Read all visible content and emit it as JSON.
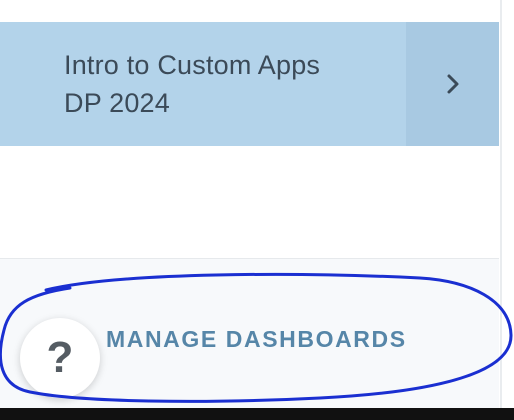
{
  "dashboard_item": {
    "label_line1": "Intro to Custom Apps",
    "label_line2": "DP 2024",
    "chevron_icon": "chevron-right-icon"
  },
  "bottom_panel": {
    "manage_label": "MANAGE DASHBOARDS",
    "help_label": "?",
    "help_icon": "question-mark-icon"
  },
  "colors": {
    "item_bg": "#b3d3ea",
    "chevron_bg": "#a8c9e2",
    "manage_text": "#5686a8",
    "annotation_ink": "#1a2fd1"
  }
}
